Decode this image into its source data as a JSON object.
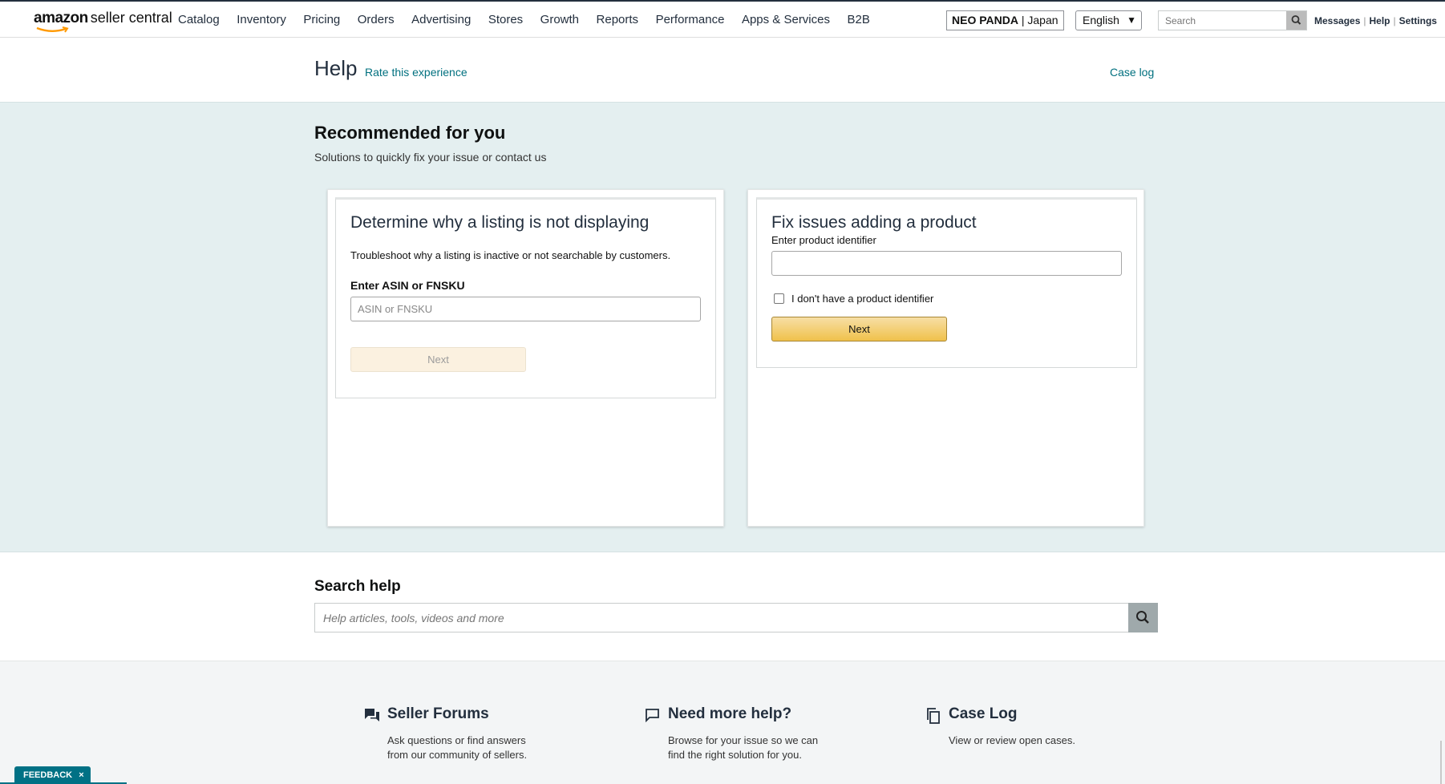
{
  "nav": {
    "logo_amazon": "amazon",
    "logo_product": "seller central",
    "links": [
      "Catalog",
      "Inventory",
      "Pricing",
      "Orders",
      "Advertising",
      "Stores",
      "Growth",
      "Reports",
      "Performance",
      "Apps & Services",
      "B2B"
    ],
    "store_name": "NEO PANDA",
    "store_region": "Japan",
    "language": "English",
    "search_placeholder": "Search",
    "right_links": [
      "Messages",
      "Help",
      "Settings"
    ]
  },
  "help_header": {
    "title": "Help",
    "rate_link": "Rate this experience",
    "case_log_link": "Case log"
  },
  "recommended": {
    "title": "Recommended for you",
    "subtitle": "Solutions to quickly fix your issue or contact us",
    "card_listing": {
      "title": "Determine why a listing is not displaying",
      "description": "Troubleshoot why a listing is inactive or not searchable by customers.",
      "input_label": "Enter ASIN or FNSKU",
      "input_placeholder": "ASIN or FNSKU",
      "input_value": "",
      "button_label": "Next",
      "button_state": "disabled"
    },
    "card_product": {
      "title": "Fix issues adding a product",
      "input_label": "Enter product identifier",
      "input_value": "",
      "checkbox_label": "I don't have a product identifier",
      "checkbox_checked": false,
      "button_label": "Next"
    }
  },
  "search_help": {
    "title": "Search help",
    "placeholder": "Help articles, tools, videos and more"
  },
  "footer": {
    "seller_forums": {
      "icon": "forum-icon",
      "title": "Seller Forums",
      "description": "Ask questions or find answers from our community of sellers."
    },
    "need_help": {
      "icon": "chat-icon",
      "title": "Need more help?",
      "description": "Browse for your issue so we can find the right solution for you."
    },
    "case_log": {
      "icon": "copy-icon",
      "title": "Case Log",
      "description": "View or review open cases."
    }
  },
  "feedback": {
    "label": "FEEDBACK",
    "close": "×"
  },
  "colors": {
    "accent_teal": "#007185",
    "link_teal": "#00707f",
    "recommend_band_bg": "#e4eff0",
    "primary_button": "#f0c14b",
    "nav_dark": "#232f3e"
  }
}
